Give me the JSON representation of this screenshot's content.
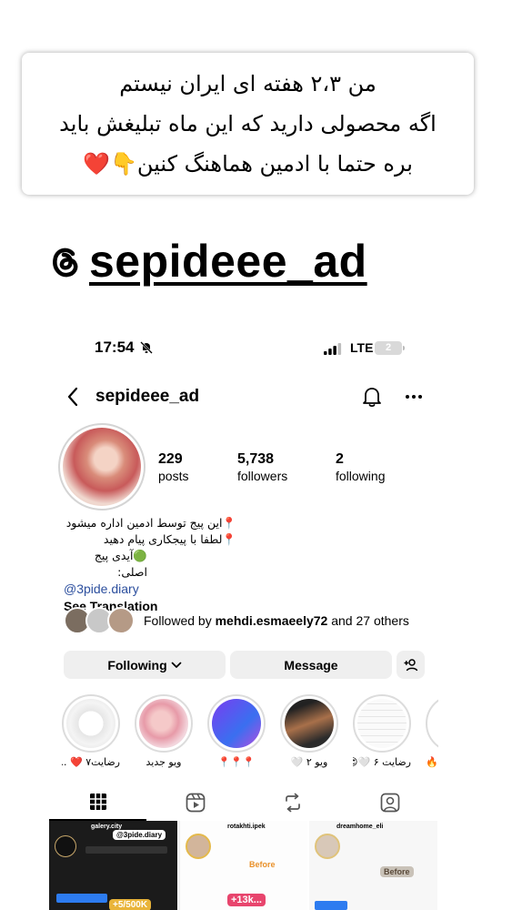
{
  "story": {
    "caption_lines": [
      "من ۲،۳ هفته ای ایران نیستم",
      "اگه محصولی دارید که این ماه تبلیغش باید",
      "بره حتما با ادمین هماهنگ کنین👇❤️"
    ],
    "handle": "sepideee_ad"
  },
  "status_bar": {
    "time": "17:54",
    "network": "LTE",
    "battery": "2"
  },
  "profile": {
    "username": "sepideee_ad",
    "stats": {
      "posts": {
        "value": "229",
        "label": "posts"
      },
      "followers": {
        "value": "5,738",
        "label": "followers"
      },
      "following": {
        "value": "2",
        "label": "following"
      }
    },
    "bio": {
      "line1": "📍این پیج توسط ادمین اداره میشود",
      "line2": "📍لطفا با پیجکاری پیام دهید",
      "line3": "🟢آیدی پیج اصلی:",
      "link": "@3pide.diary",
      "see_translation": "See Translation"
    },
    "followed_by": {
      "prefix": "Followed by ",
      "user": "mehdi.esmaeely72",
      "suffix": " and 27 others"
    },
    "buttons": {
      "following": "Following",
      "message": "Message"
    }
  },
  "highlights": [
    {
      "label": "رضایت۷ ❤️ ..."
    },
    {
      "label": "ویو جدید"
    },
    {
      "label": "📍📍📍"
    },
    {
      "label": "ویو ۲ 🤍"
    },
    {
      "label": "رضایت ۶ 🤍😍"
    },
    {
      "label": "🔥🔥"
    }
  ],
  "grid": {
    "post1": {
      "account": "galery.city",
      "tag": "@3pide.diary",
      "price": "+5/500K"
    },
    "post2": {
      "account": "rotakhti.ipek",
      "before": "Before",
      "price": "+13k..."
    },
    "post3": {
      "account": "dreamhome_eli",
      "before": "Before"
    }
  },
  "colors": {
    "button_bg": "#efefef",
    "link": "#2c4f9e",
    "highlight_ring": "#dcdcdc"
  }
}
